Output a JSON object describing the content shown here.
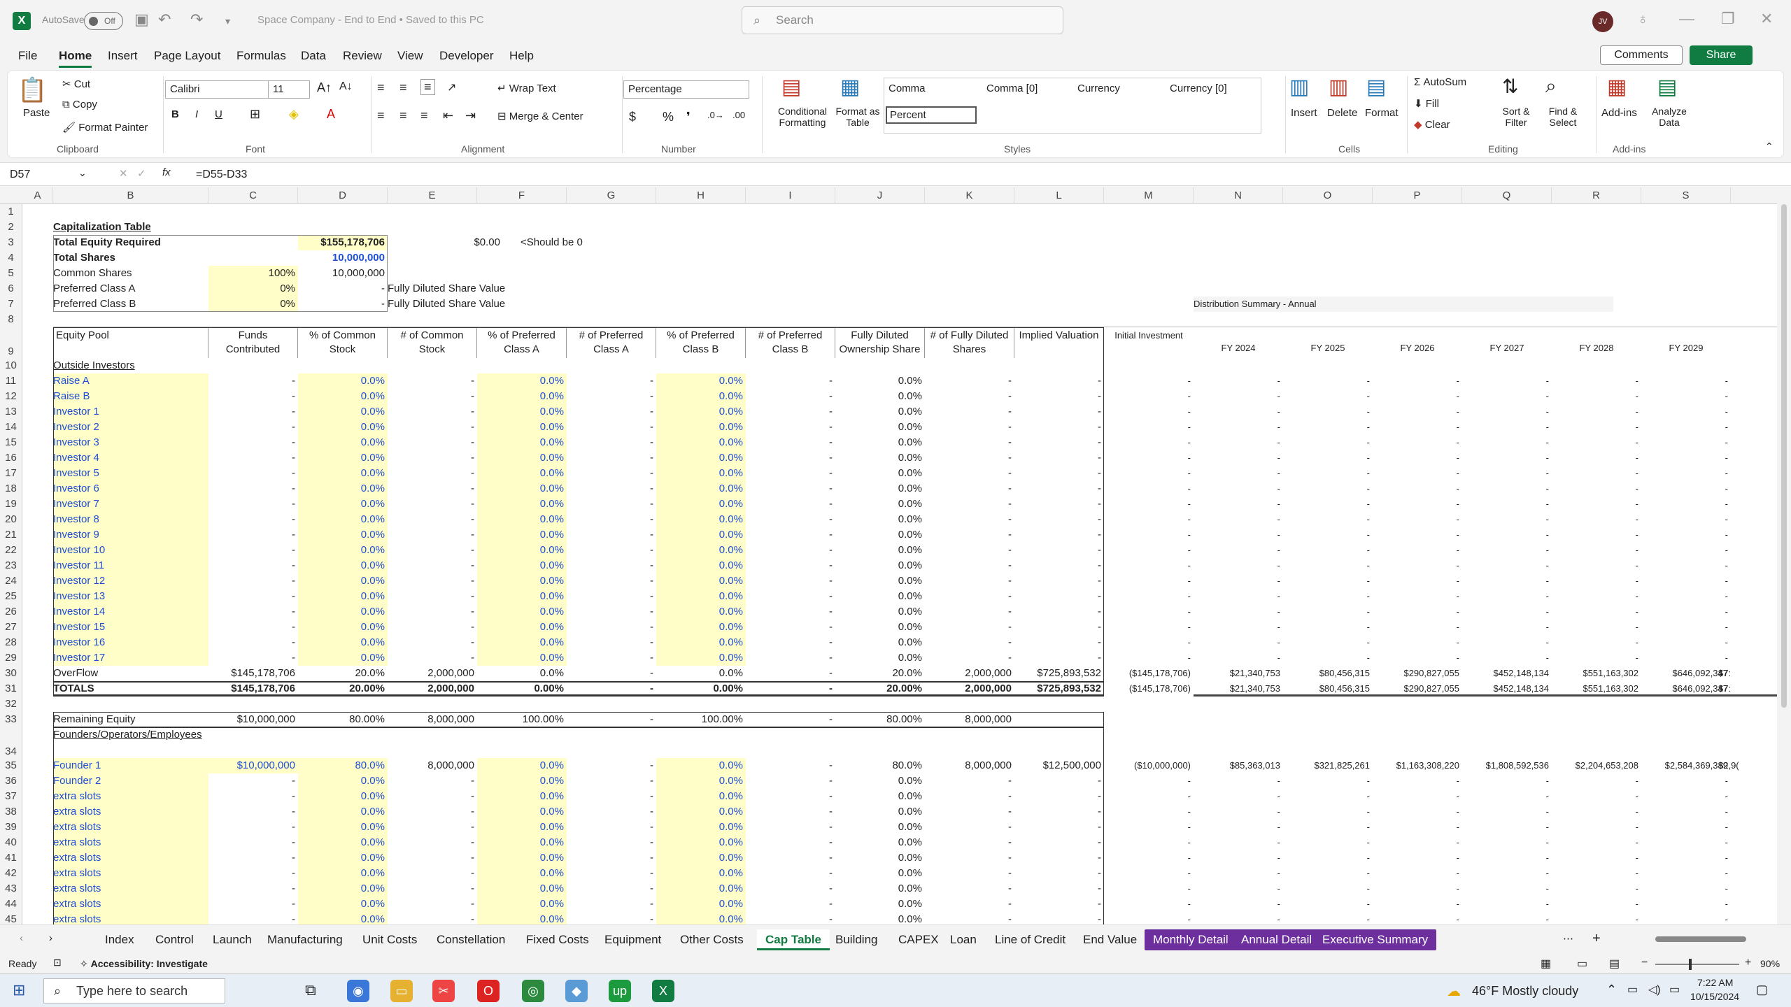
{
  "titlebar": {
    "autosave": "AutoSave",
    "toggle": "Off",
    "doc_title": "Space Company - End to End  •  Saved to this PC",
    "search_placeholder": "Search",
    "avatar": "JV"
  },
  "menu": {
    "items": [
      "File",
      "Home",
      "Insert",
      "Page Layout",
      "Formulas",
      "Data",
      "Review",
      "View",
      "Developer",
      "Help"
    ],
    "active": "Home",
    "comments": "Comments",
    "share": "Share"
  },
  "ribbon": {
    "clipboard": {
      "paste": "Paste",
      "cut": "Cut",
      "copy": "Copy",
      "format_painter": "Format Painter",
      "label": "Clipboard"
    },
    "font": {
      "name": "Calibri",
      "size": "11",
      "label": "Font"
    },
    "alignment": {
      "wrap": "Wrap Text",
      "merge": "Merge & Center",
      "label": "Alignment"
    },
    "number": {
      "format": "Percentage",
      "label": "Number"
    },
    "styles": {
      "cond": "Conditional Formatting",
      "table": "Format as Table",
      "cells": [
        "Comma",
        "Comma [0]",
        "Currency",
        "Currency [0]",
        "Percent"
      ],
      "label": "Styles"
    },
    "cells": {
      "insert": "Insert",
      "delete": "Delete",
      "format": "Format",
      "label": "Cells"
    },
    "editing": {
      "autosum": "AutoSum",
      "fill": "Fill",
      "clear": "Clear",
      "sort": "Sort & Filter",
      "find": "Find & Select",
      "label": "Editing"
    },
    "addins": {
      "addins": "Add-ins",
      "analyze": "Analyze Data",
      "label": "Add-ins"
    }
  },
  "formula": {
    "cell": "D57",
    "content": "=D55-D33"
  },
  "columns": [
    "A",
    "B",
    "C",
    "D",
    "E",
    "F",
    "G",
    "H",
    "I",
    "J",
    "K",
    "L",
    "M",
    "N",
    "O",
    "P",
    "Q",
    "R",
    "S"
  ],
  "top": {
    "title": "Capitalization Table",
    "r3": {
      "label": "Total Equity Required",
      "d": "$155,178,706",
      "f": "$0.00",
      "g": "<Should be 0"
    },
    "r4": {
      "label": "Total Shares",
      "d": "10,000,000"
    },
    "r5": {
      "label": "Common Shares",
      "c": "100%",
      "d": "10,000,000"
    },
    "r6": {
      "label": "Preferred Class A",
      "c": "0%",
      "d": "-",
      "e": "Fully Diluted Share Value"
    },
    "r7": {
      "label": "Preferred Class B",
      "c": "0%",
      "d": "-",
      "e": "Fully Diluted Share Value"
    },
    "dist": "Distribution Summary - Annual"
  },
  "headers": {
    "b": "Equity Pool",
    "c": "Funds Contributed",
    "d": "% of Common Stock",
    "e": "# of Common Stock",
    "f": "% of Preferred Class A",
    "g": "# of Preferred Class A",
    "h": "% of Preferred Class B",
    "i": "# of Preferred Class B",
    "j": "Fully Diluted Ownership Share",
    "k": "# of Fully Diluted Shares",
    "l": "Implied Valuation",
    "m": "Initial Investment",
    "fy": [
      "FY 2024",
      "FY 2025",
      "FY 2026",
      "FY 2027",
      "FY 2028",
      "FY 2029"
    ]
  },
  "outside": {
    "label": "Outside Investors",
    "names": [
      "Raise A",
      "Raise B",
      "Investor 1",
      "Investor 2",
      "Investor 3",
      "Investor 4",
      "Investor 5",
      "Investor 6",
      "Investor 7",
      "Investor 8",
      "Investor 9",
      "Investor 10",
      "Investor 11",
      "Investor 12",
      "Investor 13",
      "Investor 14",
      "Investor 15",
      "Investor 16",
      "Investor 17"
    ]
  },
  "zero": {
    "dash": "-",
    "pct": "0.0%"
  },
  "overflow": {
    "label": "OverFlow",
    "c": "$145,178,706",
    "d": "20.0%",
    "e": "2,000,000",
    "f": "0.0%",
    "g": "-",
    "h": "0.0%",
    "i": "-",
    "j": "20.0%",
    "k": "2,000,000",
    "l": "$725,893,532",
    "m": "($145,178,706)",
    "fy": [
      "$21,340,753",
      "$80,456,315",
      "$290,827,055",
      "$452,148,134",
      "$551,163,302",
      "$646,092,347"
    ],
    "cut": "$7:"
  },
  "totals": {
    "label": "TOTALS",
    "c": "$145,178,706",
    "d": "20.00%",
    "e": "2,000,000",
    "f": "0.00%",
    "g": "-",
    "h": "0.00%",
    "i": "-",
    "j": "20.00%",
    "k": "2,000,000",
    "l": "$725,893,532",
    "m": "($145,178,706)",
    "fy": [
      "$21,340,753",
      "$80,456,315",
      "$290,827,055",
      "$452,148,134",
      "$551,163,302",
      "$646,092,347"
    ],
    "cut": "$7:"
  },
  "remaining": {
    "label": "Remaining Equity",
    "c": "$10,000,000",
    "d": "80.00%",
    "e": "8,000,000",
    "f": "100.00%",
    "g": "-",
    "h": "100.00%",
    "i": "-",
    "j": "80.00%",
    "k": "8,000,000"
  },
  "founders_label": "Founders/Operators/Employees",
  "founder1": {
    "label": "Founder 1",
    "c": "$10,000,000",
    "d": "80.0%",
    "e": "8,000,000",
    "f": "0.0%",
    "g": "-",
    "h": "0.0%",
    "i": "-",
    "j": "80.0%",
    "k": "8,000,000",
    "l": "$12,500,000",
    "m": "($10,000,000)",
    "fy": [
      "$85,363,013",
      "$321,825,261",
      "$1,163,308,220",
      "$1,808,592,536",
      "$2,204,653,208",
      "$2,584,369,389"
    ],
    "cut": "$2,9("
  },
  "founder_rows": [
    "Founder 2",
    "extra slots",
    "extra slots",
    "extra slots",
    "extra slots",
    "extra slots",
    "extra slots",
    "extra slots",
    "extra slots",
    "extra slots"
  ],
  "tabs": [
    "Index",
    "Control",
    "Launch",
    "Manufacturing",
    "Unit Costs",
    "Constellation",
    "Fixed Costs",
    "Equipment",
    "Other Costs",
    "Cap Table",
    "Building",
    "CAPEX",
    "Loan",
    "Line of Credit",
    "End Value",
    "Monthly Detail",
    "Annual Detail",
    "Executive Summary"
  ],
  "active_tab": "Cap Table",
  "status": {
    "ready": "Ready",
    "access": "Accessibility: Investigate",
    "zoom": "90%"
  },
  "taskbar": {
    "search": "Type here to search",
    "weather": "46°F  Mostly cloudy",
    "time": "7:22 AM",
    "date": "10/15/2024"
  }
}
